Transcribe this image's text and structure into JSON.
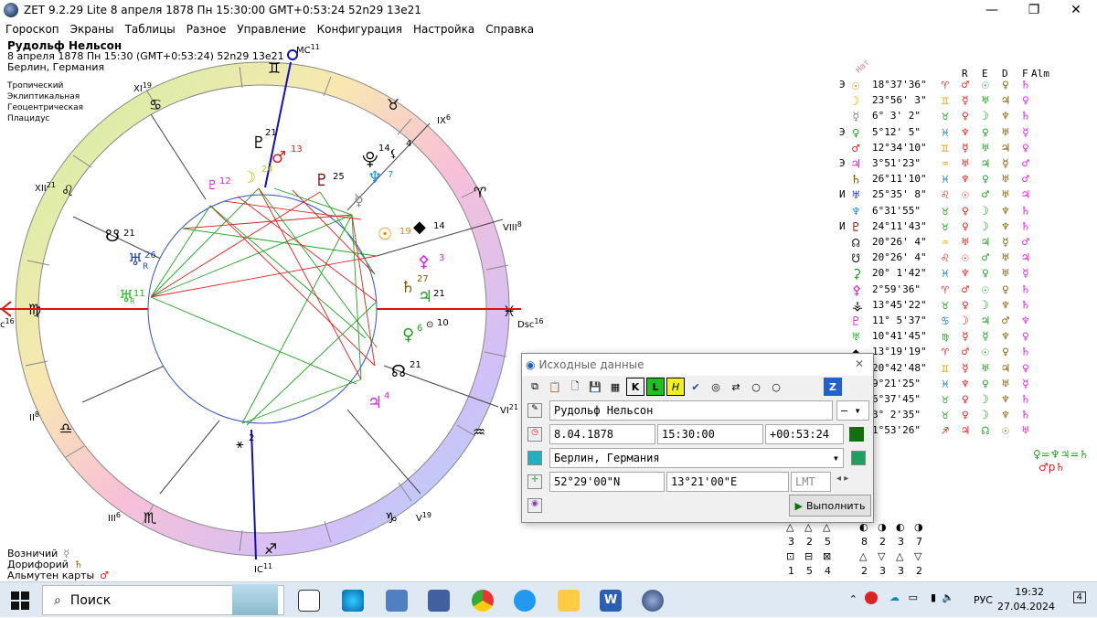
{
  "window": {
    "title": "ZET 9.2.29 Lite    8 апреля 1878  Пн  15:30:00 GMT+0:53:24 52n29  13e21",
    "controls": [
      "—",
      "❐",
      "✕"
    ]
  },
  "menu": [
    "Гороскоп",
    "Экраны",
    "Таблицы",
    "Разное",
    "Управление",
    "Конфигурация",
    "Настройка",
    "Справка"
  ],
  "header": {
    "name": "Рудольф Нельсон",
    "datetime": "8 апреля 1878  Пн  15:30 (GMT+0:53:24) 52n29  13e21",
    "place": "Берлин, Германия"
  },
  "options": [
    "Тропический",
    "Эклиптикальная",
    "Геоцентрическая",
    "Плацидус"
  ],
  "wheel": {
    "house_labels": [
      {
        "label": "MC",
        "deg": "11"
      },
      {
        "label": "XI",
        "deg": "19"
      },
      {
        "label": "XII",
        "deg": "21"
      },
      {
        "label": "II",
        "deg": "8"
      },
      {
        "label": "III",
        "deg": "6"
      },
      {
        "label": "IC",
        "deg": "11"
      },
      {
        "label": "V",
        "deg": "19"
      },
      {
        "label": "VI",
        "deg": "21"
      },
      {
        "label": "Dsc",
        "deg": "16"
      },
      {
        "label": "VIII",
        "deg": "8"
      },
      {
        "label": "IX",
        "deg": "6"
      },
      {
        "label": "c",
        "deg": "16"
      }
    ],
    "planet_degrees": {
      "pluto": "21",
      "mars": "13",
      "moon": "24",
      "proserpina": "12",
      "uranus_a": "25",
      "karma": "14",
      "neptune": "7",
      "lilith": "4",
      "sun": "19",
      "mercury": "14",
      "ceres": "3",
      "saturn": "27",
      "jupiter_b": "21",
      "venus": "6",
      "venus_b": "10",
      "node": "21",
      "jupiter": "4",
      "selena": "2",
      "south_node": "21",
      "chiron": "26",
      "chiron_r": "R",
      "pluto_h": "11",
      "pluto_h_r": "R",
      "lilith_r": "R"
    }
  },
  "bottom_labels": [
    {
      "label": "Возничий",
      "sym": "☿"
    },
    {
      "label": "Дорифорий",
      "sym": "♄"
    },
    {
      "label": "Альмутен карты",
      "sym": "♂"
    }
  ],
  "table": {
    "col_headers": [
      "Нат",
      "R",
      "E",
      "D",
      "F",
      "Alm"
    ],
    "rows": [
      {
        "pre": "Э",
        "pl": "☉",
        "pc": "#f08000",
        "pos": "18°37'36\"",
        "sign": "♈",
        "r": "♂",
        "e": "☉",
        "d": "♀",
        "f": "♄"
      },
      {
        "pre": "",
        "pl": "☽",
        "pc": "#c8c800",
        "pos": "23°56' 3\"",
        "sign": "♊",
        "r": "☿",
        "e": "♅",
        "d": "♃",
        "f": "♀"
      },
      {
        "pre": "",
        "pl": "☿",
        "pc": "#888888",
        "pos": " 6° 3' 2\"",
        "sign": "♉",
        "r": "♀",
        "e": "☽",
        "d": "♆",
        "f": "♄"
      },
      {
        "pre": "Э",
        "pl": "♀",
        "pc": "#20a020",
        "pos": " 5°12' 5\"",
        "sign": "♓",
        "r": "♆",
        "e": "♀",
        "d": "♅",
        "f": "☿"
      },
      {
        "pre": "",
        "pl": "♂",
        "pc": "#e02020",
        "pos": "12°34'10\"",
        "sign": "♊",
        "r": "☿",
        "e": "♅",
        "d": "♃",
        "f": "♀"
      },
      {
        "pre": "Э",
        "pl": "♃",
        "pc": "#e020e0",
        "pos": " 3°51'23\"",
        "sign": "♒",
        "r": "♅",
        "e": "♃",
        "d": "☿",
        "f": "♂"
      },
      {
        "pre": "",
        "pl": "♄",
        "pc": "#806000",
        "pos": "26°11'10\"",
        "sign": "♓",
        "r": "♆",
        "e": "♀",
        "d": "♅",
        "f": "♂"
      },
      {
        "pre": "И",
        "pl": "♅",
        "pc": "#2040c0",
        "pos": "25°35' 8\"",
        "sign": "♌",
        "r": "☉",
        "e": "♂",
        "d": "♅",
        "f": "♃"
      },
      {
        "pre": "",
        "pl": "♆",
        "pc": "#2090e0",
        "pos": " 6°31'55\"",
        "sign": "♉",
        "r": "♀",
        "e": "☽",
        "d": "♆",
        "f": "♄"
      },
      {
        "pre": "И",
        "pl": "♇",
        "pc": "#800000",
        "pos": "24°11'43\"",
        "sign": "♉",
        "r": "♀",
        "e": "☽",
        "d": "♆",
        "f": "♄"
      },
      {
        "pre": "",
        "pl": "☊",
        "pc": "#000000",
        "pos": "20°26' 4\"",
        "sign": "♒",
        "r": "♅",
        "e": "♃",
        "d": "☿",
        "f": "♂"
      },
      {
        "pre": "",
        "pl": "☋",
        "pc": "#000000",
        "pos": "20°26' 4\"",
        "sign": "♌",
        "r": "☉",
        "e": "♂",
        "d": "♅",
        "f": "♃"
      },
      {
        "pre": "",
        "pl": "⚳",
        "pc": "#20a020",
        "pos": "20° 1'42\"",
        "sign": "♓",
        "r": "♆",
        "e": "♀",
        "d": "♅",
        "f": "☿"
      },
      {
        "pre": "",
        "pl": "⚴",
        "pc": "#e020e0",
        "pos": " 2°59'36\"",
        "sign": "♈",
        "r": "♂",
        "e": "☉",
        "d": "♀",
        "f": "♄"
      },
      {
        "pre": "",
        "pl": "⚶",
        "pc": "#000000",
        "pos": "13°45'22\"",
        "sign": "♉",
        "r": "♀",
        "e": "☽",
        "d": "♆",
        "f": "♄"
      },
      {
        "pre": "",
        "pl": "♇",
        "pc": "#e020e0",
        "pos": "11° 5'37\"",
        "sign": "♋",
        "r": "☽",
        "e": "♃",
        "d": "♂",
        "f": "♆"
      },
      {
        "pre": "",
        "pl": "♅",
        "pc": "#20c020",
        "pos": "10°41'45\"",
        "sign": "♍",
        "r": "☿",
        "e": "☿",
        "d": "♆",
        "f": "♀"
      },
      {
        "pre": "",
        "pl": "◆",
        "pc": "#000000",
        "pos": "13°19'19\"",
        "sign": "♈",
        "r": "♂",
        "e": "☉",
        "d": "♀",
        "f": "♄"
      },
      {
        "pre": "",
        "pl": "",
        "pc": "#000000",
        "pos": "20°42'48\"",
        "sign": "♊",
        "r": "☿",
        "e": "♅",
        "d": "♃",
        "f": "♀"
      },
      {
        "pre": "",
        "pl": "",
        "pc": "#000000",
        "pos": " 9°21'25\"",
        "sign": "♓",
        "r": "♆",
        "e": "♀",
        "d": "♅",
        "f": "☿"
      },
      {
        "pre": "",
        "pl": "",
        "pc": "#000000",
        "pos": " 6°37'45\"",
        "sign": "♉",
        "r": "♀",
        "e": "☽",
        "d": "♆",
        "f": "♄"
      },
      {
        "pre": "",
        "pl": "",
        "pc": "#000000",
        "pos": " 3° 2'35\"",
        "sign": "♉",
        "r": "♀",
        "e": "☽",
        "d": "♆",
        "f": "♄"
      },
      {
        "pre": "",
        "pl": "",
        "pc": "#000000",
        "pos": " 1°53'26\"",
        "sign": "♐",
        "r": "♃",
        "e": "☊",
        "d": "☉",
        "f": "♅"
      }
    ],
    "extra_line1": "♀=♆♃=♄",
    "extra_line2": "♂p♄"
  },
  "dialog": {
    "title": "Исходные данные",
    "name_value": "Рудольф Нельсон",
    "name_suffix": "—",
    "date_value": "8.04.1878",
    "time_value": "15:30:00",
    "tz_value": "+00:53:24",
    "place_value": "Берлин, Германия",
    "lat_value": "52°29'00\"N",
    "lon_value": "13°21'00\"E",
    "lmt_label": "LMT",
    "run_button": "Выполнить"
  },
  "legend_grid": {
    "row1": [
      "3",
      "2",
      "5",
      "8",
      "2",
      "3",
      "7"
    ],
    "row2": [
      "1",
      "5",
      "4",
      "2",
      "3",
      "3",
      "2"
    ]
  },
  "taskbar": {
    "search_placeholder": "Поиск",
    "lang": "РУС",
    "time": "19:32",
    "date": "27.04.2024",
    "notif": "4"
  }
}
